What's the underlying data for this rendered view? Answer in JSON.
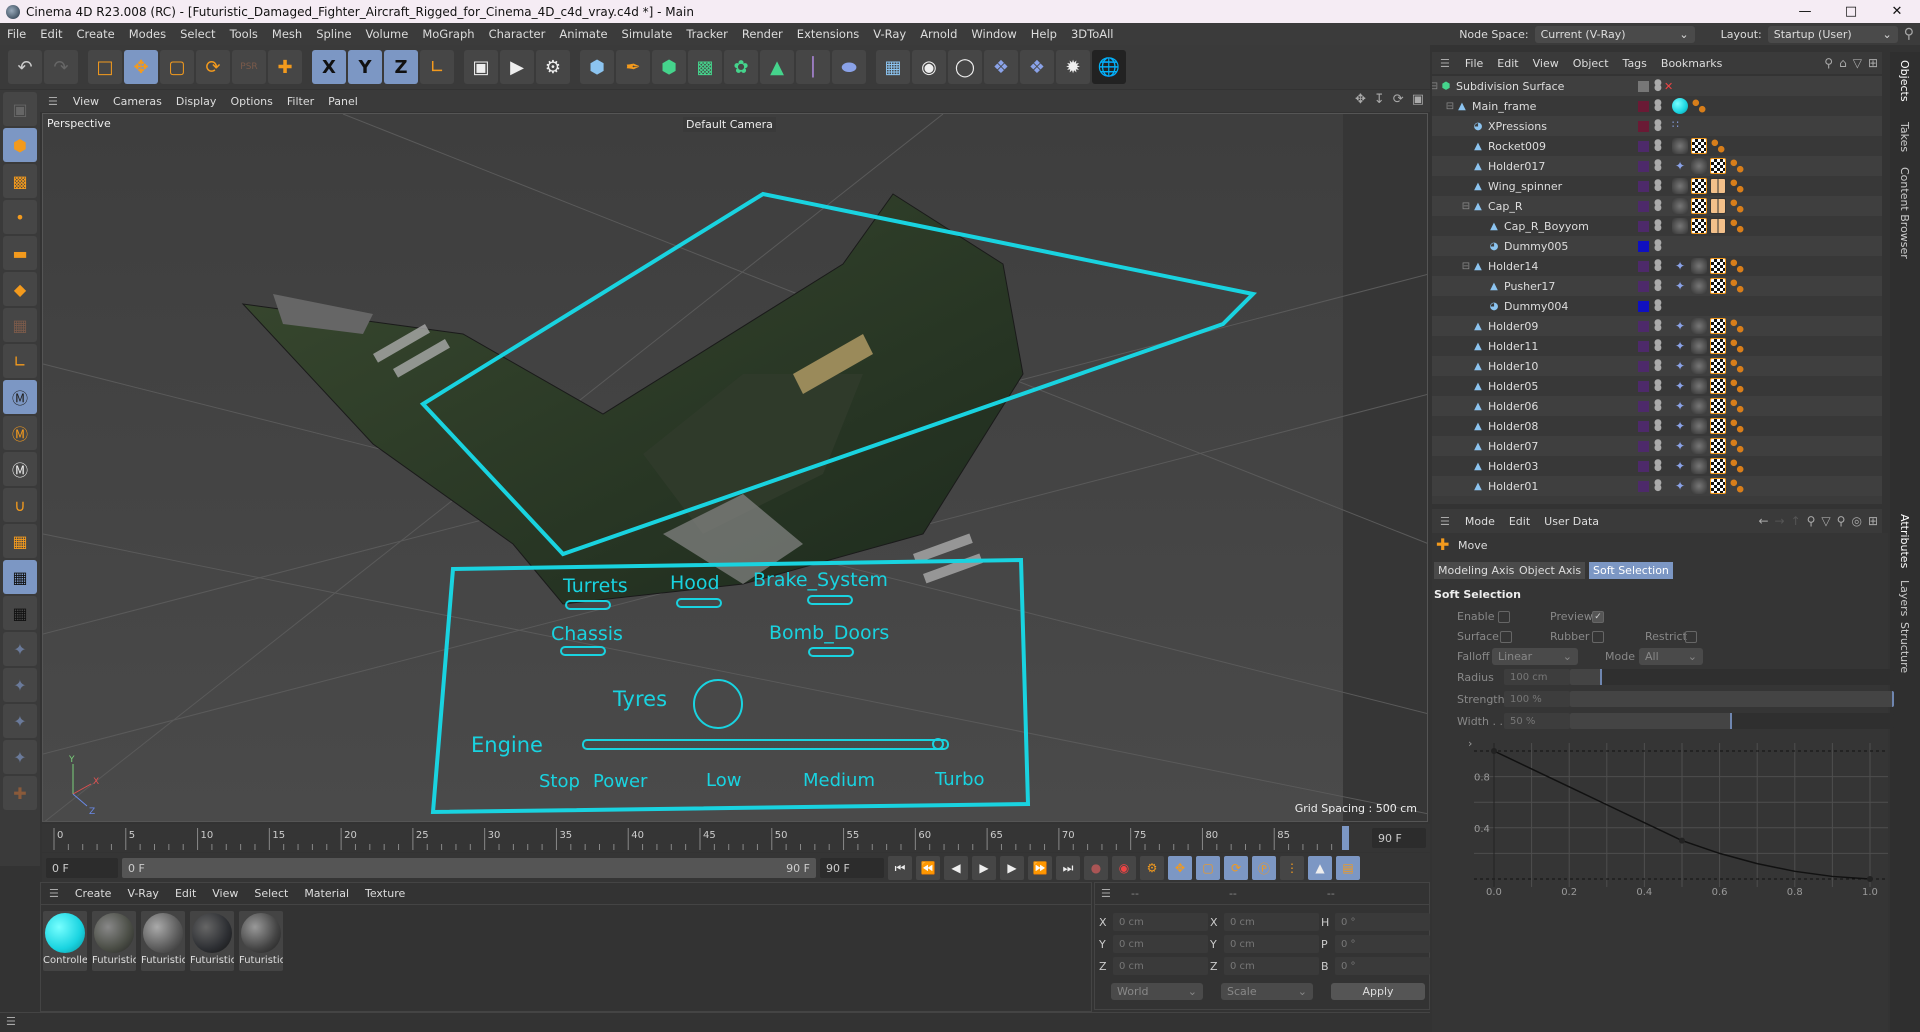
{
  "window": {
    "title": "Cinema 4D R23.008 (RC) - [Futuristic_Damaged_Fighter_Aircraft_Rigged_for_Cinema_4D_c4d_vray.c4d *] - Main",
    "controls": [
      "minimize",
      "maximize",
      "close"
    ]
  },
  "menubar": {
    "items": [
      "File",
      "Edit",
      "Create",
      "Modes",
      "Select",
      "Tools",
      "Mesh",
      "Spline",
      "Volume",
      "MoGraph",
      "Character",
      "Animate",
      "Simulate",
      "Tracker",
      "Render",
      "Extensions",
      "V-Ray",
      "Arnold",
      "Window",
      "Help",
      "3DToAll"
    ],
    "node_space_label": "Node Space:",
    "node_space_value": "Current (V-Ray)",
    "layout_label": "Layout:",
    "layout_value": "Startup (User)"
  },
  "toolbar": {
    "buttons": [
      {
        "icon": "undo-icon",
        "active": false
      },
      {
        "icon": "redo-icon",
        "active": false
      },
      {
        "icon": "select-icon",
        "active": false
      },
      {
        "icon": "move-icon",
        "active": true
      },
      {
        "icon": "scale-icon",
        "active": false
      },
      {
        "icon": "rotate-icon",
        "active": false
      },
      {
        "icon": "psr-icon",
        "active": false
      },
      {
        "icon": "transform-icon",
        "active": false
      },
      {
        "icon": "x-axis-icon",
        "label": "X",
        "active": true
      },
      {
        "icon": "y-axis-icon",
        "label": "Y",
        "active": true
      },
      {
        "icon": "z-axis-icon",
        "label": "Z",
        "active": true
      },
      {
        "icon": "coordinate-system-icon",
        "active": false
      },
      {
        "icon": "render-view-icon",
        "active": false
      },
      {
        "icon": "render-picture-viewer-icon",
        "active": false
      },
      {
        "icon": "render-settings-icon",
        "active": false
      },
      {
        "icon": "cube-icon",
        "active": false
      },
      {
        "icon": "pen-icon",
        "active": false
      },
      {
        "icon": "subdivision-icon",
        "active": false
      },
      {
        "icon": "extrude-icon",
        "active": false
      },
      {
        "icon": "cloner-icon",
        "active": false
      },
      {
        "icon": "array-icon",
        "active": false
      },
      {
        "icon": "deformer-icon",
        "active": false
      },
      {
        "icon": "field-icon",
        "active": false
      },
      {
        "icon": "floor-icon",
        "active": false
      },
      {
        "icon": "camera-icon",
        "active": false
      },
      {
        "icon": "light-icon",
        "active": false
      },
      {
        "icon": "python-icon",
        "active": false
      },
      {
        "icon": "python-icon-2",
        "active": false
      },
      {
        "icon": "vray-icon",
        "active": false
      },
      {
        "icon": "sphere-wire-icon",
        "active": false
      }
    ]
  },
  "left_tools": [
    {
      "icon": "make-editable-icon",
      "active": false
    },
    {
      "icon": "model-mode-icon",
      "active": true
    },
    {
      "icon": "texture-mode-icon",
      "active": false
    },
    {
      "icon": "points-mode-icon",
      "active": false
    },
    {
      "icon": "edges-mode-icon",
      "active": false
    },
    {
      "icon": "polygons-mode-icon",
      "active": false
    },
    {
      "icon": "uv-mode-icon",
      "active": false
    },
    {
      "icon": "axis-mode-icon",
      "active": false
    },
    {
      "icon": "solo-icon",
      "active": true
    },
    {
      "icon": "solo-hierarchy-icon",
      "active": false
    },
    {
      "icon": "solo-off-icon",
      "active": false
    },
    {
      "icon": "snap-icon",
      "active": false
    },
    {
      "icon": "workplane-icon",
      "active": false
    },
    {
      "icon": "locked-workplane-icon",
      "active": true
    },
    {
      "icon": "workplane-align-icon",
      "active": false
    },
    {
      "icon": "pin-icon",
      "active": false
    },
    {
      "icon": "pin-p-icon",
      "active": false
    },
    {
      "icon": "pin-r-icon",
      "active": false
    },
    {
      "icon": "pin-target-icon",
      "active": false
    },
    {
      "icon": "add-tool-icon",
      "active": false
    }
  ],
  "viewport": {
    "menu": [
      "View",
      "Cameras",
      "Display",
      "Options",
      "Filter",
      "Panel"
    ],
    "view_name": "Perspective",
    "camera_label": "Default Camera",
    "grid_spacing": "Grid Spacing : 500 cm",
    "nav_icons": [
      "move-view-icon",
      "zoom-view-icon",
      "rotate-view-icon",
      "maximize-view-icon"
    ],
    "controller_panel": {
      "labels": [
        "Turrets",
        "Hood",
        "Brake_System",
        "Chassis",
        "Bomb_Doors",
        "Tyres",
        "Engine"
      ],
      "engine_marks": [
        "Stop",
        "Power",
        "Low",
        "Medium",
        "Turbo"
      ],
      "color": "#19d3e0"
    },
    "axis_labels": [
      "X",
      "Y",
      "Z"
    ]
  },
  "timeline": {
    "ticks": [
      "0",
      "5",
      "10",
      "15",
      "20",
      "25",
      "30",
      "35",
      "40",
      "45",
      "50",
      "55",
      "60",
      "65",
      "70",
      "75",
      "80",
      "85"
    ],
    "current_frame": "90 F",
    "start_field": "0 F",
    "range_start": "0 F",
    "range_end": "90 F",
    "end_field": "90 F"
  },
  "transport": {
    "buttons": [
      "go-to-start-icon",
      "prev-key-icon",
      "prev-frame-icon",
      "play-icon",
      "next-frame-icon",
      "next-key-icon",
      "go-to-end-icon"
    ],
    "record": [
      "record-keys-icon",
      "auto-key-icon"
    ],
    "key_buttons": [
      "keyframe-selection-icon",
      "key-position-icon",
      "key-scale-icon",
      "key-rotation-icon",
      "key-param-icon",
      "key-pla-icon"
    ],
    "extra": [
      "scheme-icon",
      "timeline-icon"
    ]
  },
  "materials": {
    "menu": [
      "Create",
      "V-Ray",
      "Edit",
      "View",
      "Select",
      "Material",
      "Texture"
    ],
    "items": [
      {
        "name": "Controlle",
        "color": "#19d3e0"
      },
      {
        "name": "Futuristic",
        "color": "#4a4d45"
      },
      {
        "name": "Futuristic",
        "color": "#5a5a5a"
      },
      {
        "name": "Futuristic",
        "color": "#2d2f33"
      },
      {
        "name": "Futuristic",
        "color": "#444"
      }
    ]
  },
  "coordinates": {
    "headers": [
      "--",
      "--",
      "--"
    ],
    "rows": [
      {
        "l1": "X",
        "v1": "0 cm",
        "l2": "X",
        "v2": "0 cm",
        "l3": "H",
        "v3": "0 °"
      },
      {
        "l1": "Y",
        "v1": "0 cm",
        "l2": "Y",
        "v2": "0 cm",
        "l3": "P",
        "v3": "0 °"
      },
      {
        "l1": "Z",
        "v1": "0 cm",
        "l2": "Z",
        "v2": "0 cm",
        "l3": "B",
        "v3": "0 °"
      }
    ],
    "space": "World",
    "mode": "Scale",
    "apply": "Apply"
  },
  "objects": {
    "menu": [
      "File",
      "Edit",
      "View",
      "Object",
      "Tags",
      "Bookmarks"
    ],
    "rows": [
      {
        "name": "Subdivision Surface",
        "depth": 0,
        "type": "subdiv",
        "color": "",
        "tags": [],
        "expander": true
      },
      {
        "name": "Main_frame",
        "depth": 1,
        "type": "null",
        "color": "#6a1a35",
        "tags": [
          "sphere",
          "dots"
        ],
        "expander": true
      },
      {
        "name": "XPressions",
        "depth": 2,
        "type": "xp",
        "color": "#6a1a35",
        "tags": [
          "xpresso"
        ]
      },
      {
        "name": "Rocket009",
        "depth": 2,
        "type": "null",
        "color": "#4d2a6a",
        "tags": [
          "mat",
          "chk",
          "dots"
        ]
      },
      {
        "name": "Holder017",
        "depth": 2,
        "type": "null",
        "color": "#4d2a6a",
        "tags": [
          "pin",
          "mat",
          "chk",
          "dots"
        ]
      },
      {
        "name": "Wing_spinner",
        "depth": 2,
        "type": "null",
        "color": "#4d2a6a",
        "tags": [
          "mat",
          "chk",
          "grid4",
          "dots"
        ]
      },
      {
        "name": "Cap_R",
        "depth": 2,
        "type": "null",
        "color": "#4d2a6a",
        "tags": [
          "mat",
          "chk",
          "grid4",
          "dots"
        ],
        "expander": true
      },
      {
        "name": "Cap_R_Boyyom",
        "depth": 3,
        "type": "null",
        "color": "#4d2a6a",
        "tags": [
          "mat",
          "chk",
          "grid4",
          "dots"
        ]
      },
      {
        "name": "Dummy005",
        "depth": 3,
        "type": "xp",
        "color": "#1010c0",
        "tags": []
      },
      {
        "name": "Holder14",
        "depth": 2,
        "type": "null",
        "color": "#4d2a6a",
        "tags": [
          "pin",
          "mat",
          "chk",
          "dots"
        ],
        "expander": true
      },
      {
        "name": "Pusher17",
        "depth": 3,
        "type": "null",
        "color": "#4d2a6a",
        "tags": [
          "pin",
          "mat",
          "chk",
          "dots"
        ]
      },
      {
        "name": "Dummy004",
        "depth": 3,
        "type": "xp",
        "color": "#1010c0",
        "tags": []
      },
      {
        "name": "Holder09",
        "depth": 2,
        "type": "null",
        "color": "#4d2a6a",
        "tags": [
          "pin",
          "mat",
          "chk",
          "dots"
        ]
      },
      {
        "name": "Holder11",
        "depth": 2,
        "type": "null",
        "color": "#4d2a6a",
        "tags": [
          "pin",
          "mat",
          "chk",
          "dots"
        ]
      },
      {
        "name": "Holder10",
        "depth": 2,
        "type": "null",
        "color": "#4d2a6a",
        "tags": [
          "pin",
          "mat",
          "chk",
          "dots"
        ]
      },
      {
        "name": "Holder05",
        "depth": 2,
        "type": "null",
        "color": "#4d2a6a",
        "tags": [
          "pin",
          "mat",
          "chk",
          "dots"
        ]
      },
      {
        "name": "Holder06",
        "depth": 2,
        "type": "null",
        "color": "#4d2a6a",
        "tags": [
          "pin",
          "mat",
          "chk",
          "dots"
        ]
      },
      {
        "name": "Holder08",
        "depth": 2,
        "type": "null",
        "color": "#4d2a6a",
        "tags": [
          "pin",
          "mat",
          "chk",
          "dots"
        ]
      },
      {
        "name": "Holder07",
        "depth": 2,
        "type": "null",
        "color": "#4d2a6a",
        "tags": [
          "pin",
          "mat",
          "chk",
          "dots"
        ]
      },
      {
        "name": "Holder03",
        "depth": 2,
        "type": "null",
        "color": "#4d2a6a",
        "tags": [
          "pin",
          "mat",
          "chk",
          "dots"
        ]
      },
      {
        "name": "Holder01",
        "depth": 2,
        "type": "null",
        "color": "#4d2a6a",
        "tags": [
          "pin",
          "mat",
          "chk",
          "dots"
        ]
      }
    ]
  },
  "side_tabs_top": [
    "Objects",
    "Takes",
    "Content Browser"
  ],
  "side_tabs_bottom": [
    "Attributes",
    "Layers",
    "Structure"
  ],
  "attributes": {
    "menu": [
      "Mode",
      "Edit",
      "User Data"
    ],
    "tool_name": "Move",
    "tabs": [
      {
        "label": "Modeling Axis",
        "selected": false
      },
      {
        "label": "Object Axis",
        "selected": false
      },
      {
        "label": "Soft Selection",
        "selected": true
      }
    ],
    "section": "Soft Selection",
    "enable_label": "Enable",
    "enable": false,
    "preview_label": "Preview",
    "preview": true,
    "surface_label": "Surface",
    "surface": false,
    "rubber_label": "Rubber",
    "rubber": false,
    "restrict_label": "Restrict",
    "restrict": false,
    "falloff_label": "Falloff",
    "falloff": "Linear",
    "mode_label": "Mode",
    "mode": "All",
    "radius_label": "Radius",
    "radius": "100 cm",
    "radius_fraction": 0.1,
    "strength_label": "Strength",
    "strength": "100 %",
    "strength_fraction": 1.0,
    "width_label": "Width . .",
    "width": "50 %",
    "width_fraction": 0.5,
    "curve": {
      "x_ticks": [
        "0.0",
        "0.2",
        "0.4",
        "0.6",
        "0.8",
        "1.0"
      ],
      "y_ticks": [
        "0.4",
        "0.8"
      ],
      "points": [
        [
          0,
          1.0
        ],
        [
          0.1,
          0.86
        ],
        [
          0.2,
          0.72
        ],
        [
          0.3,
          0.58
        ],
        [
          0.4,
          0.44
        ],
        [
          0.5,
          0.3
        ],
        [
          0.6,
          0.2
        ],
        [
          0.7,
          0.12
        ],
        [
          0.8,
          0.06
        ],
        [
          0.9,
          0.02
        ],
        [
          1.0,
          0.0
        ]
      ]
    }
  }
}
